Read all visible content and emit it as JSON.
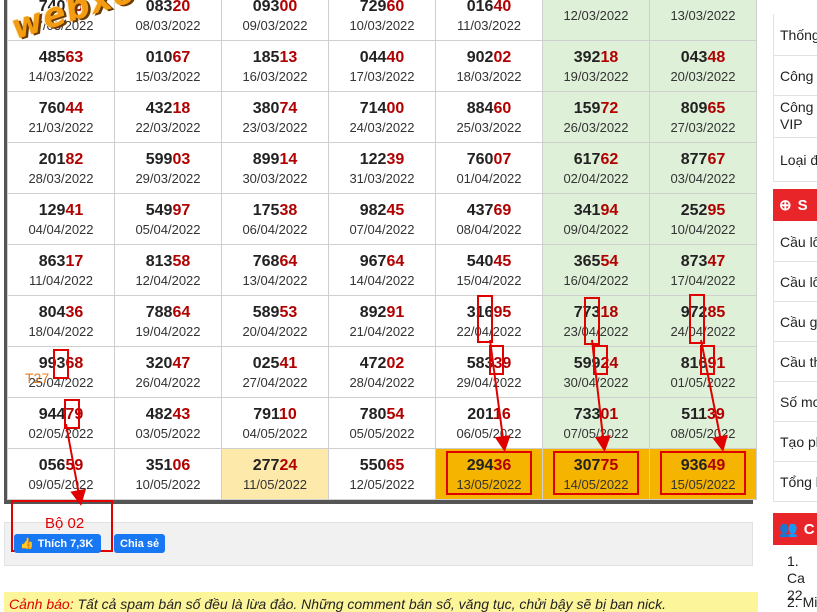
{
  "watermark": "webxoso.net",
  "grid": {
    "rows": [
      [
        {
          "head": "740",
          "tail": "75",
          "date": "07/03/2022",
          "partial": true
        },
        {
          "head": "083",
          "tail": "20",
          "date": "08/03/2022",
          "partial": true
        },
        {
          "head": "093",
          "tail": "00",
          "date": "09/03/2022",
          "partial": true
        },
        {
          "head": "729",
          "tail": "60",
          "date": "10/03/2022",
          "partial": true
        },
        {
          "head": "016",
          "tail": "40",
          "date": "11/03/2022",
          "partial": true
        },
        {
          "head": "",
          "tail": "",
          "date": "12/03/2022",
          "partial": true
        },
        {
          "head": "",
          "tail": "",
          "date": "13/03/2022",
          "partial": true
        }
      ],
      [
        {
          "head": "485",
          "tail": "63",
          "date": "14/03/2022"
        },
        {
          "head": "010",
          "tail": "67",
          "date": "15/03/2022"
        },
        {
          "head": "185",
          "tail": "13",
          "date": "16/03/2022"
        },
        {
          "head": "044",
          "tail": "40",
          "date": "17/03/2022"
        },
        {
          "head": "902",
          "tail": "02",
          "date": "18/03/2022"
        },
        {
          "head": "392",
          "tail": "18",
          "date": "19/03/2022"
        },
        {
          "head": "043",
          "tail": "48",
          "date": "20/03/2022"
        }
      ],
      [
        {
          "head": "760",
          "tail": "44",
          "date": "21/03/2022"
        },
        {
          "head": "432",
          "tail": "18",
          "date": "22/03/2022"
        },
        {
          "head": "380",
          "tail": "74",
          "date": "23/03/2022"
        },
        {
          "head": "714",
          "tail": "00",
          "date": "24/03/2022"
        },
        {
          "head": "884",
          "tail": "60",
          "date": "25/03/2022"
        },
        {
          "head": "159",
          "tail": "72",
          "date": "26/03/2022"
        },
        {
          "head": "809",
          "tail": "65",
          "date": "27/03/2022"
        }
      ],
      [
        {
          "head": "201",
          "tail": "82",
          "date": "28/03/2022"
        },
        {
          "head": "599",
          "tail": "03",
          "date": "29/03/2022"
        },
        {
          "head": "899",
          "tail": "14",
          "date": "30/03/2022"
        },
        {
          "head": "122",
          "tail": "39",
          "date": "31/03/2022"
        },
        {
          "head": "760",
          "tail": "07",
          "date": "01/04/2022"
        },
        {
          "head": "617",
          "tail": "62",
          "date": "02/04/2022"
        },
        {
          "head": "877",
          "tail": "67",
          "date": "03/04/2022"
        }
      ],
      [
        {
          "head": "129",
          "tail": "41",
          "date": "04/04/2022"
        },
        {
          "head": "549",
          "tail": "97",
          "date": "05/04/2022"
        },
        {
          "head": "175",
          "tail": "38",
          "date": "06/04/2022"
        },
        {
          "head": "982",
          "tail": "45",
          "date": "07/04/2022"
        },
        {
          "head": "437",
          "tail": "69",
          "date": "08/04/2022"
        },
        {
          "head": "341",
          "tail": "94",
          "date": "09/04/2022"
        },
        {
          "head": "252",
          "tail": "95",
          "date": "10/04/2022"
        }
      ],
      [
        {
          "head": "863",
          "tail": "17",
          "date": "11/04/2022"
        },
        {
          "head": "813",
          "tail": "58",
          "date": "12/04/2022"
        },
        {
          "head": "768",
          "tail": "64",
          "date": "13/04/2022"
        },
        {
          "head": "967",
          "tail": "64",
          "date": "14/04/2022"
        },
        {
          "head": "540",
          "tail": "45",
          "date": "15/04/2022"
        },
        {
          "head": "365",
          "tail": "54",
          "date": "16/04/2022"
        },
        {
          "head": "873",
          "tail": "47",
          "date": "17/04/2022"
        }
      ],
      [
        {
          "head": "804",
          "tail": "36",
          "date": "18/04/2022"
        },
        {
          "head": "788",
          "tail": "64",
          "date": "19/04/2022"
        },
        {
          "head": "589",
          "tail": "53",
          "date": "20/04/2022"
        },
        {
          "head": "892",
          "tail": "91",
          "date": "21/04/2022"
        },
        {
          "head": "316",
          "tail": "95",
          "date": "22/04/2022"
        },
        {
          "head": "773",
          "tail": "18",
          "date": "23/04/2022"
        },
        {
          "head": "972",
          "tail": "85",
          "date": "24/04/2022"
        }
      ],
      [
        {
          "head": "993",
          "tail": "68",
          "date": "25/04/2022"
        },
        {
          "head": "320",
          "tail": "47",
          "date": "26/04/2022"
        },
        {
          "head": "025",
          "tail": "41",
          "date": "27/04/2022"
        },
        {
          "head": "472",
          "tail": "02",
          "date": "28/04/2022"
        },
        {
          "head": "583",
          "tail": "39",
          "date": "29/04/2022"
        },
        {
          "head": "599",
          "tail": "24",
          "date": "30/04/2022"
        },
        {
          "head": "816",
          "tail": "91",
          "date": "01/05/2022"
        }
      ],
      [
        {
          "head": "944",
          "tail": "79",
          "date": "02/05/2022"
        },
        {
          "head": "482",
          "tail": "43",
          "date": "03/05/2022"
        },
        {
          "head": "791",
          "tail": "10",
          "date": "04/05/2022"
        },
        {
          "head": "780",
          "tail": "54",
          "date": "05/05/2022"
        },
        {
          "head": "201",
          "tail": "16",
          "date": "06/05/2022"
        },
        {
          "head": "733",
          "tail": "01",
          "date": "07/05/2022"
        },
        {
          "head": "511",
          "tail": "39",
          "date": "08/05/2022"
        }
      ],
      [
        {
          "head": "056",
          "tail": "59",
          "date": "09/05/2022"
        },
        {
          "head": "351",
          "tail": "06",
          "date": "10/05/2022"
        },
        {
          "head": "277",
          "tail": "24",
          "date": "11/05/2022",
          "state": "today"
        },
        {
          "head": "550",
          "tail": "65",
          "date": "12/05/2022"
        },
        {
          "head": "294",
          "tail": "36",
          "date": "13/05/2022",
          "state": "hit"
        },
        {
          "head": "307",
          "tail": "75",
          "date": "14/05/2022",
          "state": "hit"
        },
        {
          "head": "936",
          "tail": "49",
          "date": "15/05/2022",
          "state": "hit"
        }
      ]
    ]
  },
  "annotations": {
    "t27": "T27",
    "bo02": "Bộ 02"
  },
  "share": {
    "like_label": "Thích 7,3K",
    "share_label": "Chia sẻ"
  },
  "warning": {
    "label": "Cảnh báo:",
    "text": " Tất cả spam bán số đều là lừa đảo. Những comment bán số, văng tục, chửi bậy sẽ bị ban nick."
  },
  "sidebar": {
    "items_top": [
      "Thống",
      "Công",
      "Công VIP",
      "Loại đ"
    ],
    "section1_title": "S",
    "items_mid": [
      "Cầu lô",
      "Cầu lô",
      "Cầu g",
      "Cầu th",
      "Số mơ",
      "Tạo ph",
      "Tổng h"
    ],
    "section2_title": "C",
    "list": [
      "1. Ca 22",
      "2. Mi"
    ]
  },
  "colors": {
    "weekend": "#dff0d8",
    "today": "#fdeaaa",
    "hit": "#f5b400",
    "tail": "#b10000",
    "annotation": "#e00000",
    "sidebar_head": "#e8262a"
  }
}
